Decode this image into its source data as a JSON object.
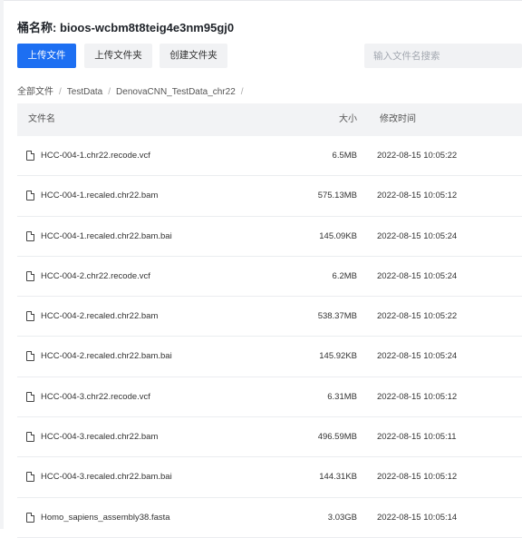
{
  "bucket": {
    "title": "桶名称: bioos-wcbm8t8teig4e3nm95gj0"
  },
  "toolbar": {
    "upload_file_label": "上传文件",
    "upload_folder_label": "上传文件夹",
    "create_folder_label": "创建文件夹",
    "search_placeholder": "输入文件名搜索",
    "search_value": ""
  },
  "breadcrumb": {
    "items": [
      "全部文件",
      "TestData",
      "DenovaCNN_TestData_chr22"
    ],
    "separator": "/"
  },
  "table": {
    "headers": {
      "name": "文件名",
      "size": "大小",
      "mtime": "修改时间"
    },
    "rows": [
      {
        "name": "HCC-004-1.chr22.recode.vcf",
        "size": "6.5MB",
        "mtime": "2022-08-15 10:05:22"
      },
      {
        "name": "HCC-004-1.recaled.chr22.bam",
        "size": "575.13MB",
        "mtime": "2022-08-15 10:05:12"
      },
      {
        "name": "HCC-004-1.recaled.chr22.bam.bai",
        "size": "145.09KB",
        "mtime": "2022-08-15 10:05:24"
      },
      {
        "name": "HCC-004-2.chr22.recode.vcf",
        "size": "6.2MB",
        "mtime": "2022-08-15 10:05:24"
      },
      {
        "name": "HCC-004-2.recaled.chr22.bam",
        "size": "538.37MB",
        "mtime": "2022-08-15 10:05:22"
      },
      {
        "name": "HCC-004-2.recaled.chr22.bam.bai",
        "size": "145.92KB",
        "mtime": "2022-08-15 10:05:24"
      },
      {
        "name": "HCC-004-3.chr22.recode.vcf",
        "size": "6.31MB",
        "mtime": "2022-08-15 10:05:12"
      },
      {
        "name": "HCC-004-3.recaled.chr22.bam",
        "size": "496.59MB",
        "mtime": "2022-08-15 10:05:11"
      },
      {
        "name": "HCC-004-3.recaled.chr22.bam.bai",
        "size": "144.31KB",
        "mtime": "2022-08-15 10:05:12"
      },
      {
        "name": "Homo_sapiens_assembly38.fasta",
        "size": "3.03GB",
        "mtime": "2022-08-15 10:05:14"
      }
    ]
  },
  "icons": {
    "file": "file-icon"
  },
  "colors": {
    "primary": "#1d6ff2",
    "header_bg": "#f2f3f5",
    "secondary_btn_bg": "#f1f2f4"
  }
}
